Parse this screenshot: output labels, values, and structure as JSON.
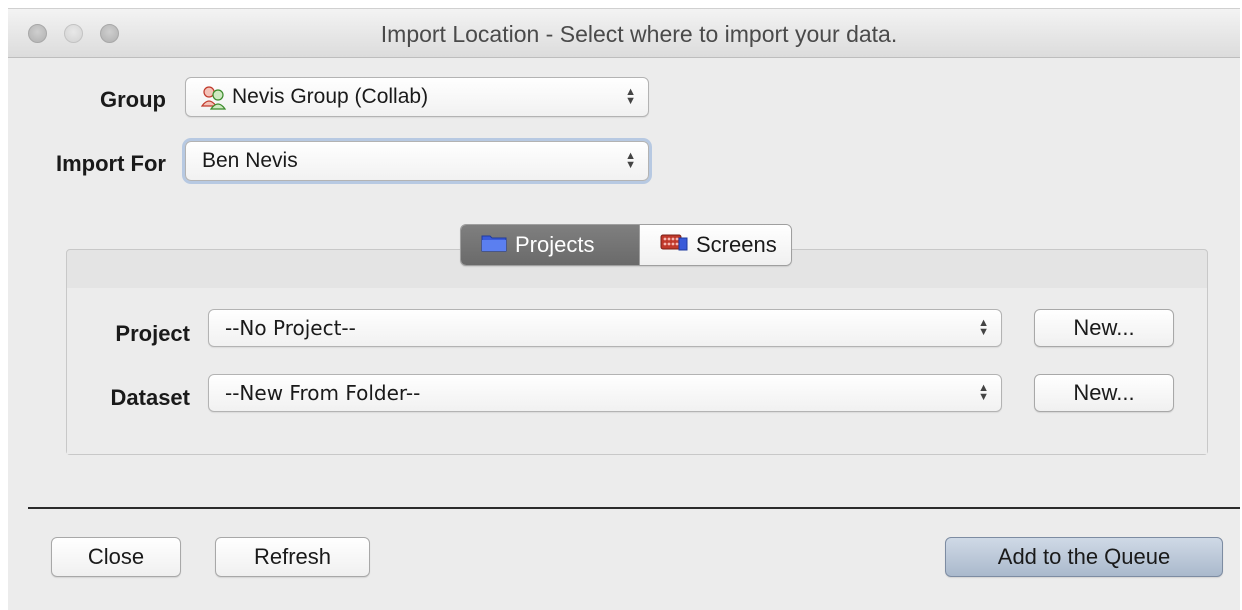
{
  "window": {
    "title": "Import Location - Select where to import your data."
  },
  "group": {
    "label": "Group",
    "selected": "Nevis Group (Collab)",
    "icon": "group-people-icon"
  },
  "import_for": {
    "label": "Import For",
    "selected": "Ben Nevis"
  },
  "tabs": [
    {
      "label": "Projects",
      "icon": "folder-icon",
      "active": true
    },
    {
      "label": "Screens",
      "icon": "plate-icon",
      "active": false
    }
  ],
  "project": {
    "label": "Project",
    "selected": "--No Project--",
    "new_label": "New..."
  },
  "dataset": {
    "label": "Dataset",
    "selected": "--New From Folder--",
    "new_label": "New..."
  },
  "footer": {
    "close_label": "Close",
    "refresh_label": "Refresh",
    "add_label": "Add to the Queue"
  },
  "colors": {
    "active_tab": "#737373",
    "primary_button": "#b9c6d8",
    "window_bg": "#ececec"
  }
}
